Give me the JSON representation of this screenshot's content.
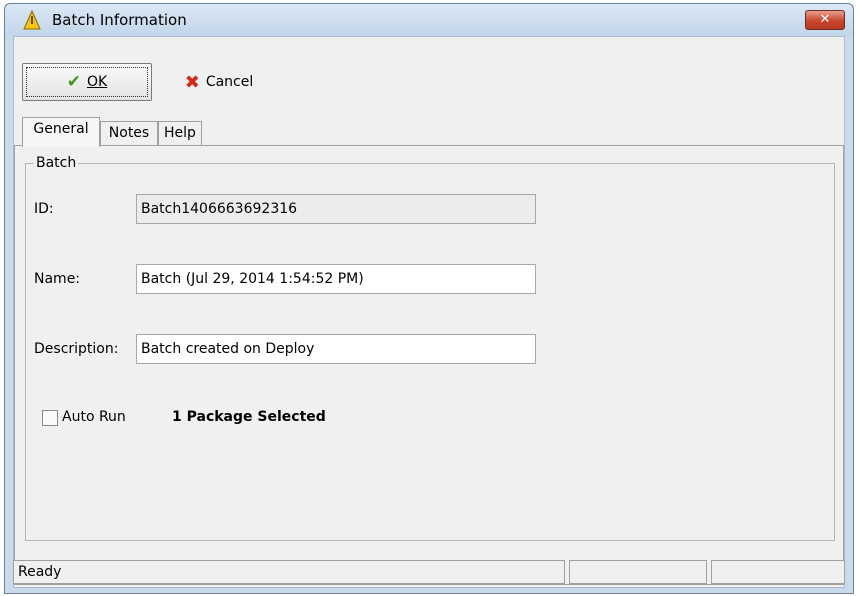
{
  "window": {
    "title": "Batch Information",
    "close_icon": "close-x-icon"
  },
  "toolbar": {
    "ok_label": "OK",
    "cancel_label": "Cancel"
  },
  "tabs": [
    {
      "label": "General"
    },
    {
      "label": "Notes"
    },
    {
      "label": "Help"
    }
  ],
  "group": {
    "legend": "Batch"
  },
  "form": {
    "id_label": "ID:",
    "id_value": "Batch1406663692316",
    "name_label": "Name:",
    "name_value": "Batch (Jul 29, 2014 1:54:52 PM)",
    "description_label": "Description:",
    "description_value": "Batch created on Deploy",
    "auto_run_label": "Auto Run",
    "auto_run_checked": false,
    "selection_summary": "1 Package Selected"
  },
  "status": {
    "text": "Ready"
  }
}
